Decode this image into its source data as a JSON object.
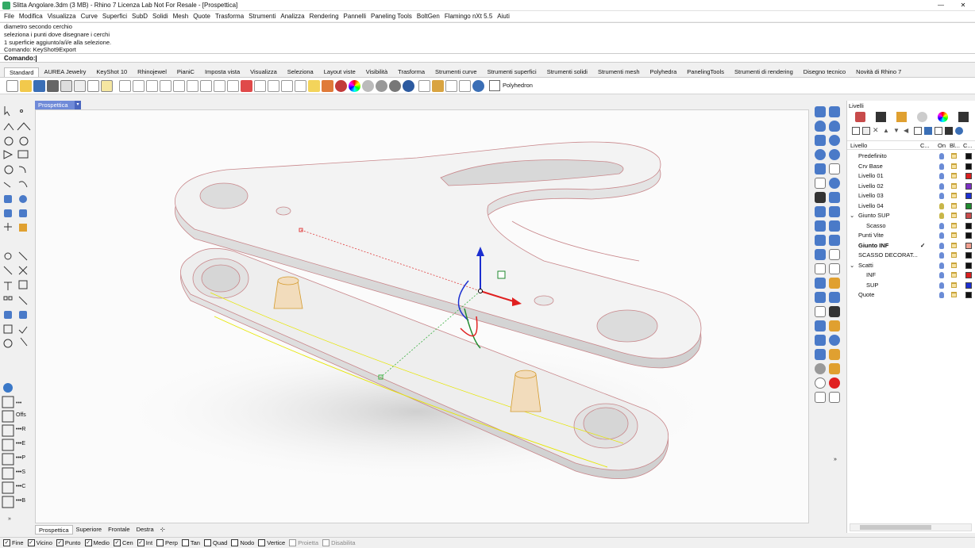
{
  "window": {
    "title": "Slitta Angolare.3dm (3 MB) - Rhino 7 Licenza Lab Not For Resale - [Prospettica]"
  },
  "menu": [
    "File",
    "Modifica",
    "Visualizza",
    "Curve",
    "Superfici",
    "SubD",
    "Solidi",
    "Mesh",
    "Quote",
    "Trasforma",
    "Strumenti",
    "Analizza",
    "Rendering",
    "Pannelli",
    "Paneling Tools",
    "BoltGen",
    "Flamingo nXt 5.5",
    "Aiuti"
  ],
  "history": {
    "lines": [
      "diametro secondo cerchio",
      "seleziona i punti dove disegnare i cerchi",
      "1 superficie aggiunto/a/i/e alla selezione.",
      "Comando: KeyShot9Export"
    ]
  },
  "command": {
    "label": "Comando:",
    "value": ""
  },
  "toolbar_tabs": [
    "Standard",
    "AUREA Jewelry",
    "KeyShot 10",
    "Rhinojewel",
    "PianiC",
    "Imposta vista",
    "Visualizza",
    "Seleziona",
    "Layout viste",
    "Visibilità",
    "Trasforma",
    "Strumenti curve",
    "Strumenti superfici",
    "Strumenti solidi",
    "Strumenti mesh",
    "Polyhedra",
    "PanelingTools",
    "Strumenti di rendering",
    "Disegno tecnico",
    "Novità di Rhino 7"
  ],
  "main_toolbar": {
    "polyhedron_label": "Polyhedron"
  },
  "viewport": {
    "active_name": "Prospettica"
  },
  "left_tool_labels": {
    "offs": "Offs",
    "r": "R",
    "e": "E",
    "p": "P",
    "s": "S",
    "c": "C",
    "b": "B"
  },
  "layers_panel": {
    "title": "Livelli",
    "columns": {
      "name": "Livello",
      "c": "C...",
      "on": "On",
      "bl": "Bl...",
      "col": "C..."
    },
    "rows": [
      {
        "name": "Predefinito",
        "color": "#111111",
        "current": false,
        "indent": 0
      },
      {
        "name": "Crv Base",
        "color": "#111111",
        "current": false,
        "indent": 0
      },
      {
        "name": "Livello 01",
        "color": "#d81e1e",
        "current": false,
        "indent": 0
      },
      {
        "name": "Livello 02",
        "color": "#7b2fc4",
        "current": false,
        "indent": 0
      },
      {
        "name": "Livello 03",
        "color": "#1c2fd0",
        "current": false,
        "indent": 0
      },
      {
        "name": "Livello 04",
        "color": "#1f8a2e",
        "current": false,
        "indent": 0
      },
      {
        "name": "Giunto SUP",
        "color": "#c84b4b",
        "current": false,
        "indent": 0,
        "expander": "⌄"
      },
      {
        "name": "Scasso",
        "color": "#111111",
        "current": false,
        "indent": 1
      },
      {
        "name": "Punti Vite",
        "color": "#111111",
        "current": false,
        "indent": 0
      },
      {
        "name": "Giunto INF",
        "color": "#f0a090",
        "current": true,
        "indent": 0,
        "check": "✓"
      },
      {
        "name": "SCASSO DECORAT...",
        "color": "#111111",
        "current": false,
        "indent": 0
      },
      {
        "name": "Scatti",
        "color": "#111111",
        "current": false,
        "indent": 0,
        "expander": "⌄"
      },
      {
        "name": "INF",
        "color": "#d81e1e",
        "current": false,
        "indent": 1
      },
      {
        "name": "SUP",
        "color": "#1c2fd0",
        "current": false,
        "indent": 1
      },
      {
        "name": "Quote",
        "color": "#111111",
        "current": false,
        "indent": 0
      }
    ]
  },
  "viewport_tabs": [
    "Prospettica",
    "Superiore",
    "Frontale",
    "Destra"
  ],
  "viewport_tab_add": "⊹",
  "osnaps": [
    {
      "label": "Fine",
      "checked": true,
      "enabled": true
    },
    {
      "label": "Vicino",
      "checked": true,
      "enabled": true
    },
    {
      "label": "Punto",
      "checked": true,
      "enabled": true
    },
    {
      "label": "Medio",
      "checked": true,
      "enabled": true
    },
    {
      "label": "Cen",
      "checked": true,
      "enabled": true
    },
    {
      "label": "Int",
      "checked": true,
      "enabled": true
    },
    {
      "label": "Perp",
      "checked": false,
      "enabled": true
    },
    {
      "label": "Tan",
      "checked": false,
      "enabled": true
    },
    {
      "label": "Quad",
      "checked": false,
      "enabled": true
    },
    {
      "label": "Nodo",
      "checked": false,
      "enabled": true
    },
    {
      "label": "Vertice",
      "checked": false,
      "enabled": true
    },
    {
      "label": "Proietta",
      "checked": false,
      "enabled": false
    },
    {
      "label": "Disabilita",
      "checked": false,
      "enabled": false
    }
  ],
  "colors": {
    "accent": "#6f8ad8",
    "model_edge": "#c8868a",
    "curve": "#e6e600"
  }
}
